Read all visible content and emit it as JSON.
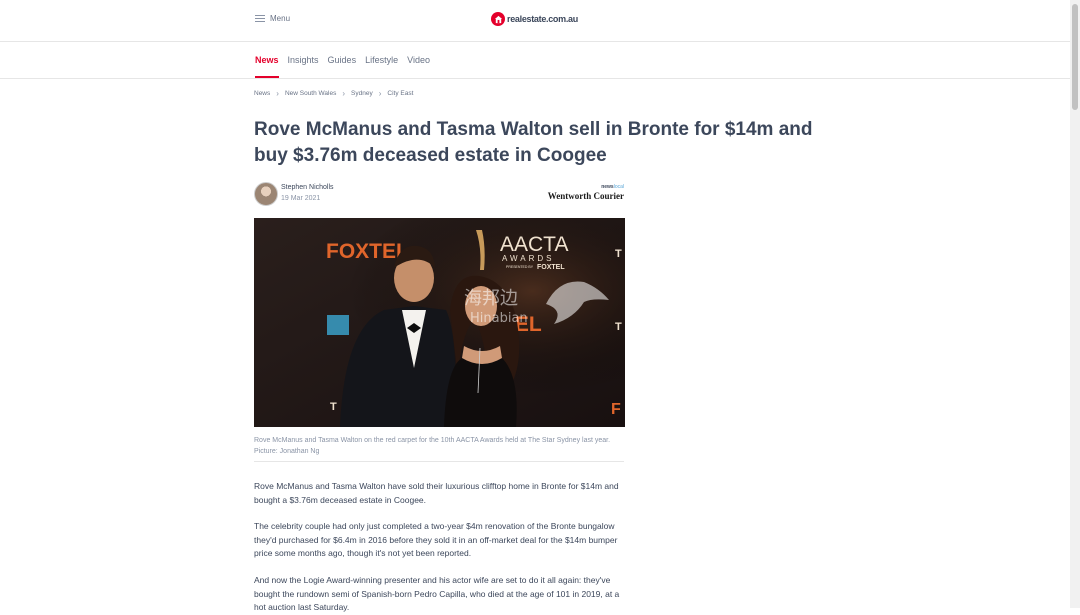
{
  "header": {
    "menu_label": "Menu",
    "logo_text": "realestate.com.au"
  },
  "nav": {
    "tabs": [
      {
        "label": "News",
        "active": true
      },
      {
        "label": "Insights",
        "active": false
      },
      {
        "label": "Guides",
        "active": false
      },
      {
        "label": "Lifestyle",
        "active": false
      },
      {
        "label": "Video",
        "active": false
      }
    ]
  },
  "breadcrumb": [
    "News",
    "New South Wales",
    "Sydney",
    "City East"
  ],
  "article": {
    "headline": "Rove McManus and Tasma Walton sell in Bronte for $14m and buy $3.76m deceased estate in Coogee",
    "author": "Stephen Nicholls",
    "date": "19 Mar 2021",
    "masthead": {
      "network_prefix": "news",
      "network_suffix": "local",
      "name": "Wentworth Courier"
    },
    "image": {
      "backdrop_texts": [
        "FOXTEL",
        "AACTA",
        "AWARDS",
        "PRESENTED BY",
        "FOXTEL",
        "TEL",
        "T",
        "T",
        "F",
        "T"
      ],
      "watermark_cn": "海邦边",
      "watermark_en": "Hinabian"
    },
    "caption": "Rove McManus and Tasma Walton on the red carpet for the 10th AACTA Awards held at The Star Sydney last year. Picture: Jonathan Ng",
    "paragraphs": [
      "Rove McManus and Tasma Walton have sold their luxurious clifftop home in Bronte for $14m and bought a $3.76m deceased estate in Coogee.",
      "The celebrity couple had only just completed a two-year $4m renovation of the Bronte bungalow they'd purchased for $6.4m in 2016 before they sold it in an off-market deal for the $14m bumper price some months ago, though it's not yet been reported.",
      "And now the Logie Award-winning presenter and his actor wife are set to do it all again: they've bought the rundown semi of Spanish-born Pedro Capilla, who died at the age of 101 in 2019, at a hot auction last Saturday."
    ]
  },
  "colors": {
    "accent": "#e4002b",
    "text": "#3c475b",
    "muted": "#697386"
  }
}
